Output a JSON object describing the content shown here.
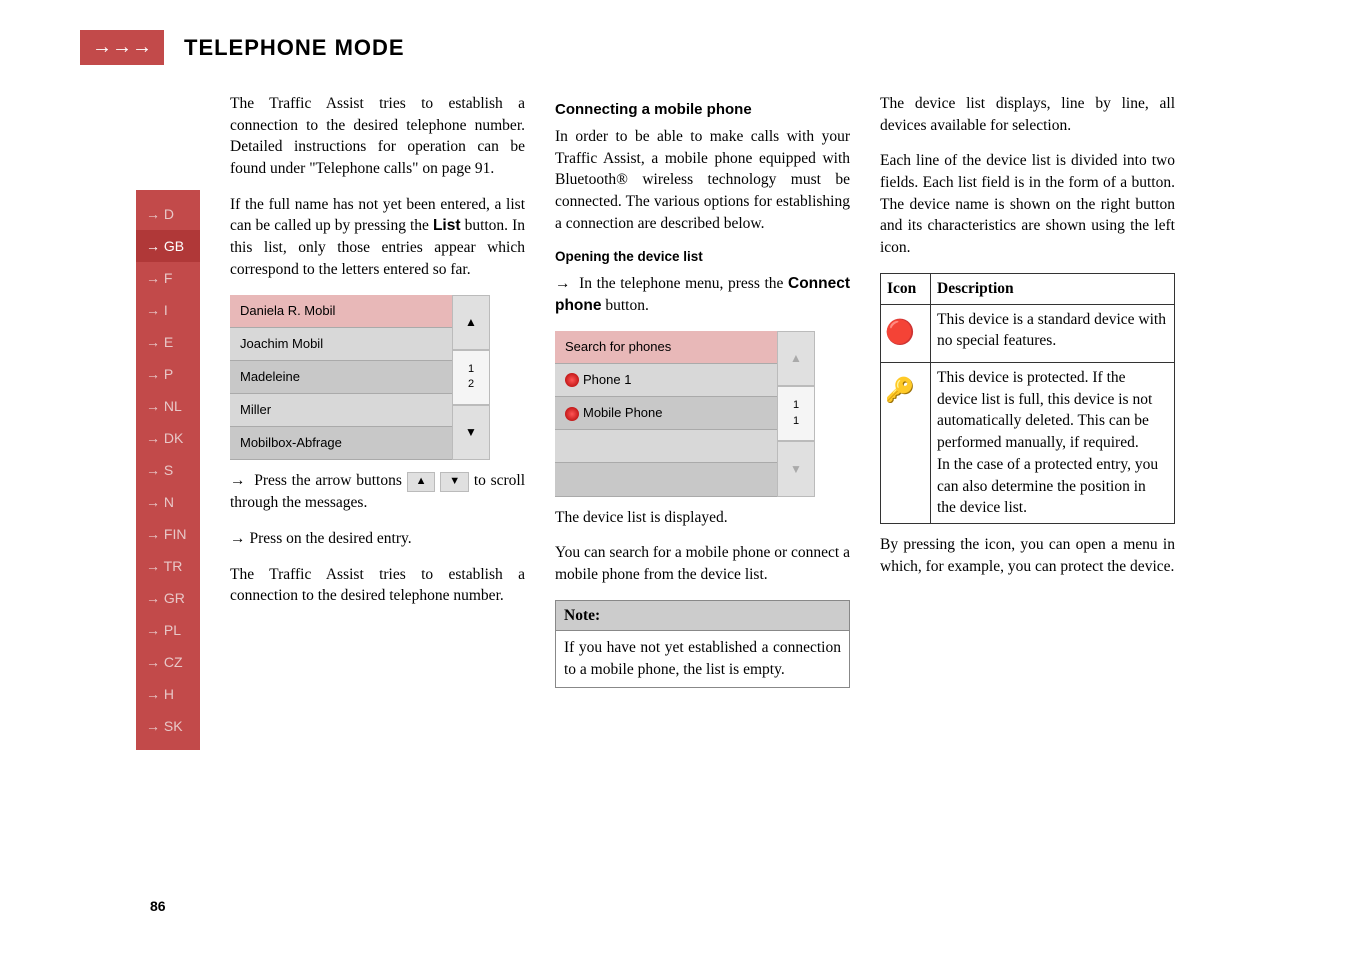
{
  "header": {
    "arrows": "→→→",
    "title": "TELEPHONE MODE"
  },
  "sidebar": {
    "items": [
      {
        "label": "→ D"
      },
      {
        "label": "→ GB",
        "active": true
      },
      {
        "label": "→ F"
      },
      {
        "label": "→ I"
      },
      {
        "label": "→ E"
      },
      {
        "label": "→ P"
      },
      {
        "label": "→ NL"
      },
      {
        "label": "→ DK"
      },
      {
        "label": "→ S"
      },
      {
        "label": "→ N"
      },
      {
        "label": "→ FIN"
      },
      {
        "label": "→ TR"
      },
      {
        "label": "→ GR"
      },
      {
        "label": "→ PL"
      },
      {
        "label": "→ CZ"
      },
      {
        "label": "→ H"
      },
      {
        "label": "→ SK"
      }
    ]
  },
  "col1": {
    "para1": "The Traffic Assist tries to establish a connection to the desired telephone number. Detailed instructions for operation can be found under \"Telephone calls\" on page 91.",
    "para2a": "If the full name has not yet been entered, a list can be called up by pressing the ",
    "para2_boldword": "List",
    "para2b": " button. In this list, only those entries appear which correspond to the letters entered so far.",
    "list_ui": {
      "rows": [
        {
          "label": "Daniela R. Mobil",
          "style": "hl"
        },
        {
          "label": "Joachim Mobil",
          "style": "alt"
        },
        {
          "label": "Madeleine",
          "style": "nrm"
        },
        {
          "label": "Miller",
          "style": "alt"
        },
        {
          "label": "Mobilbox-Abfrage",
          "style": "nrm"
        }
      ],
      "side": {
        "up": "▲",
        "indicator": "1\n2",
        "down": "▼"
      }
    },
    "bullet1a": "Press the arrow buttons ",
    "bullet1_up": "▲",
    "bullet1_down": "▼",
    "bullet1b": " to scroll through the messages.",
    "bullet2": "Press on the desired entry.",
    "para3": "The Traffic Assist tries to establish a connection to the desired telephone number."
  },
  "col2": {
    "heading1": "Connecting a mobile phone",
    "para1": "In order to be able to make calls with your Traffic Assist, a mobile phone equipped with Bluetooth® wireless technology must be connected. The various options for establishing a connection are described below.",
    "heading2": "Opening the device list",
    "bullet1a": "In the telephone menu, press the ",
    "bullet1_bold": "Connect phone",
    "bullet1b": " button.",
    "list_ui": {
      "rows": [
        {
          "label": "Search for phones",
          "style": "hl",
          "icon": false
        },
        {
          "label": "Phone 1",
          "style": "alt",
          "icon": true
        },
        {
          "label": "Mobile Phone",
          "style": "nrm",
          "icon": true
        }
      ],
      "side": {
        "up": "▲",
        "indicator": "1\n1",
        "down": "▼"
      }
    },
    "para2": "The device list is displayed.",
    "para3": "You can search for a mobile phone or connect a mobile phone from the device list.",
    "note": {
      "header": "Note:",
      "body": "If you have not yet established a connection to a mobile phone, the list is empty."
    }
  },
  "col3": {
    "para1": "The device list displays, line by line, all devices available for selection.",
    "para2": "Each line of the device list is divided into two fields. Each list field is in the form of a button. The device name is shown on the right button and its characteristics are shown using the left icon.",
    "table": {
      "head_icon": "Icon",
      "head_desc": "Description",
      "rows": [
        {
          "icon": "🔴",
          "desc": "This device is a standard device with no special features."
        },
        {
          "icon": "🔑",
          "desc": "This device is protected. If the device list is full, this device is not automatically deleted. This can be performed manually, if required.\nIn the case of a protected entry, you can also determine the position in the device list."
        }
      ]
    },
    "para3": "By pressing the icon, you can open a menu in which, for example, you can protect the device."
  },
  "page_number": "86"
}
